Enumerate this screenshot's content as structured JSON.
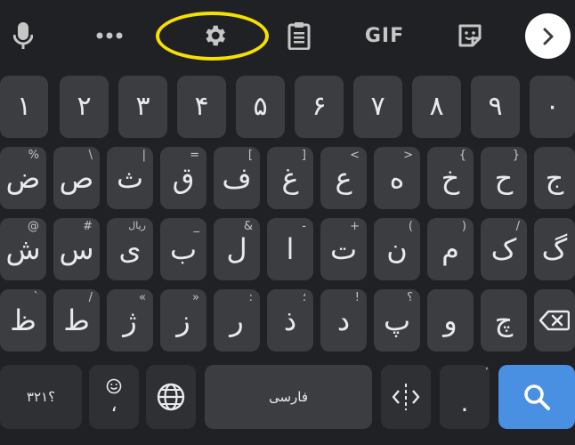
{
  "toolbar": {
    "gif_label": "GIF",
    "icons": [
      "mic-icon",
      "more-icon",
      "gear-icon",
      "clipboard-icon",
      "gif-button",
      "sticker-icon",
      "chevron-right-icon"
    ]
  },
  "rows": {
    "numbers": [
      "١",
      "٢",
      "٣",
      "۴",
      "۵",
      "۶",
      "٧",
      "٨",
      "٩",
      "٠"
    ],
    "row1": [
      {
        "main": "ض",
        "hint": "%"
      },
      {
        "main": "ص",
        "hint": "\\"
      },
      {
        "main": "ث",
        "hint": "|"
      },
      {
        "main": "ق",
        "hint": "="
      },
      {
        "main": "ف",
        "hint": "["
      },
      {
        "main": "غ",
        "hint": "]"
      },
      {
        "main": "ع",
        "hint": "<"
      },
      {
        "main": "ه",
        "hint": ">"
      },
      {
        "main": "خ",
        "hint": "{"
      },
      {
        "main": "ح",
        "hint": "}"
      },
      {
        "main": "ج",
        "hint": ""
      }
    ],
    "row2": [
      {
        "main": "ش",
        "hint": "@"
      },
      {
        "main": "س",
        "hint": "#"
      },
      {
        "main": "ی",
        "hint": "ریال"
      },
      {
        "main": "ب",
        "hint": "_"
      },
      {
        "main": "ل",
        "hint": "&"
      },
      {
        "main": "ا",
        "hint": "-"
      },
      {
        "main": "ت",
        "hint": "+"
      },
      {
        "main": "ن",
        "hint": "("
      },
      {
        "main": "م",
        "hint": ")"
      },
      {
        "main": "ک",
        "hint": "/"
      },
      {
        "main": "گ",
        "hint": ""
      }
    ],
    "row3": [
      {
        "main": "ظ",
        "hint": "`"
      },
      {
        "main": "ط",
        "hint": "/"
      },
      {
        "main": "ژ",
        "hint": "«"
      },
      {
        "main": "ز",
        "hint": "»"
      },
      {
        "main": "ر",
        "hint": ":"
      },
      {
        "main": "ذ",
        "hint": "؛"
      },
      {
        "main": "د",
        "hint": "!"
      },
      {
        "main": "پ",
        "hint": "؟"
      },
      {
        "main": "و",
        "hint": ""
      },
      {
        "main": "چ",
        "hint": ""
      }
    ]
  },
  "bottom": {
    "symbols_label": "؟٣٢١",
    "emoji_comma_label": "،",
    "space_label": "فارسی",
    "period_label": ".",
    "period_hint": "ٔ"
  },
  "colors": {
    "background": "#202124",
    "key": "#3c3d40",
    "highlight_ring": "#f6e000",
    "enter_key": "#4a90e2"
  }
}
